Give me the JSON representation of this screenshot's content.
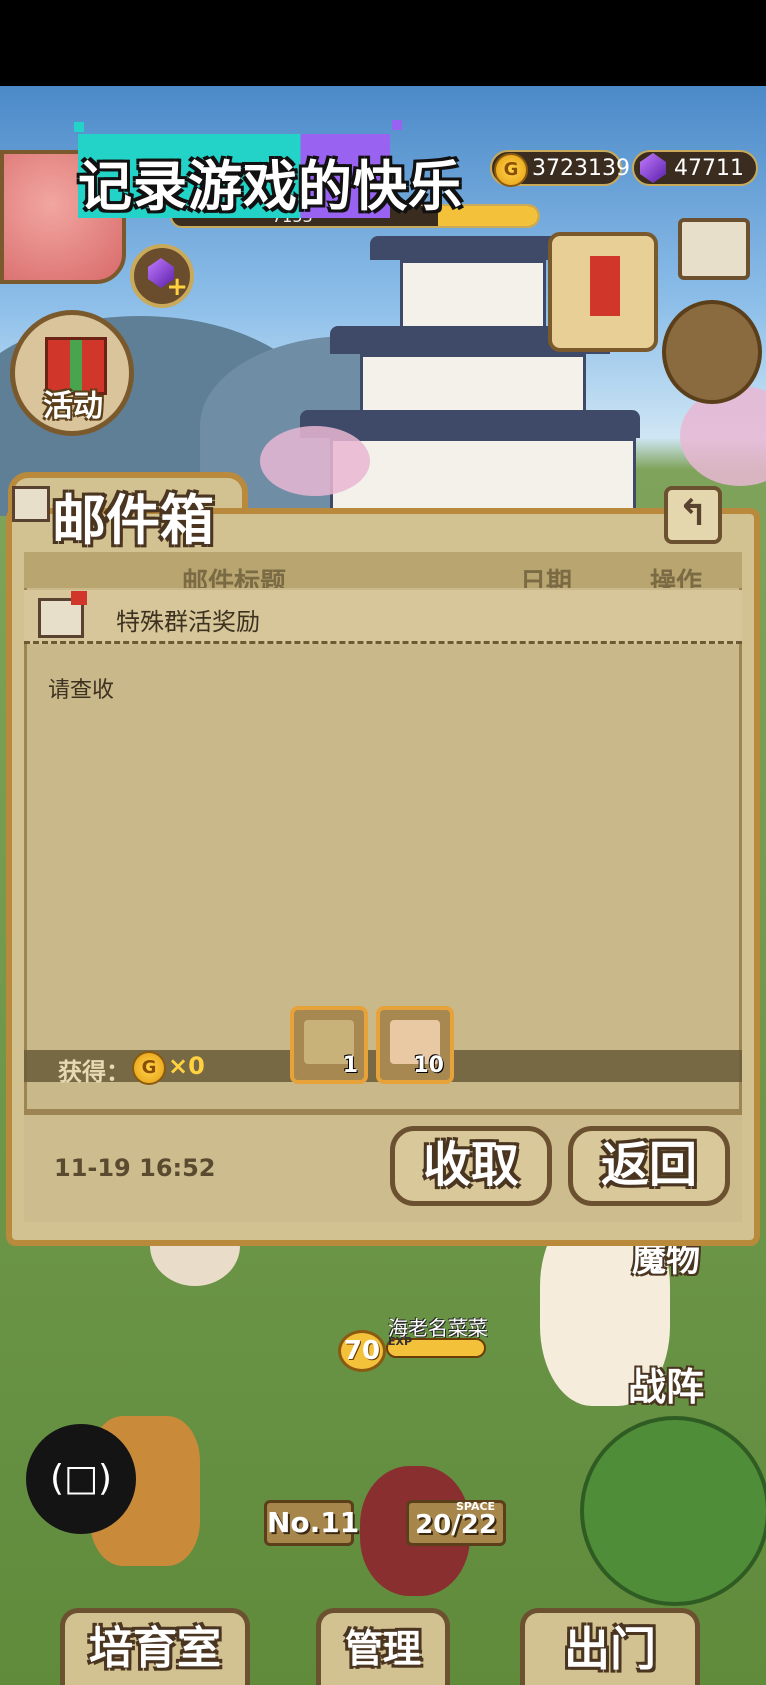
{
  "overlay": {
    "banner_text": "记录游戏的快乐"
  },
  "hud": {
    "gold": "3723139",
    "gems": "47711",
    "exp_text": "7153"
  },
  "buttons": {
    "event_label": "活动"
  },
  "mailbox": {
    "title": "邮件箱",
    "columns": {
      "title": "邮件标题",
      "date": "日期",
      "action": "操作"
    },
    "mail": {
      "subject": "特殊群活奖励",
      "body": "请查收",
      "reward_label": "获得：",
      "coin_reward": "×0",
      "items": [
        {
          "icon": "envelope-seal-icon",
          "qty": "1"
        },
        {
          "icon": "ticket-icon",
          "qty": "10"
        }
      ],
      "date": "11-19 16:52"
    },
    "collect_label": "收取",
    "return_label": "返回"
  },
  "game": {
    "monster_tab": "魔物",
    "character_name": "海老名菜菜",
    "level": "70",
    "exp_tag": "EXP",
    "formation": "战阵",
    "rank": "No.11",
    "space_tag": "SPACE",
    "space": "20/22",
    "rotate_icon": "(□)"
  },
  "bottom_nav": {
    "nursery": "培育室",
    "manage": "管理",
    "go_out": "出门"
  },
  "colors": {
    "frame": "#b98a3c",
    "parchment": "#d2c191",
    "accent": "#e8a23a",
    "banner_teal": "#23d3c8",
    "banner_purple": "#9a62f0"
  }
}
